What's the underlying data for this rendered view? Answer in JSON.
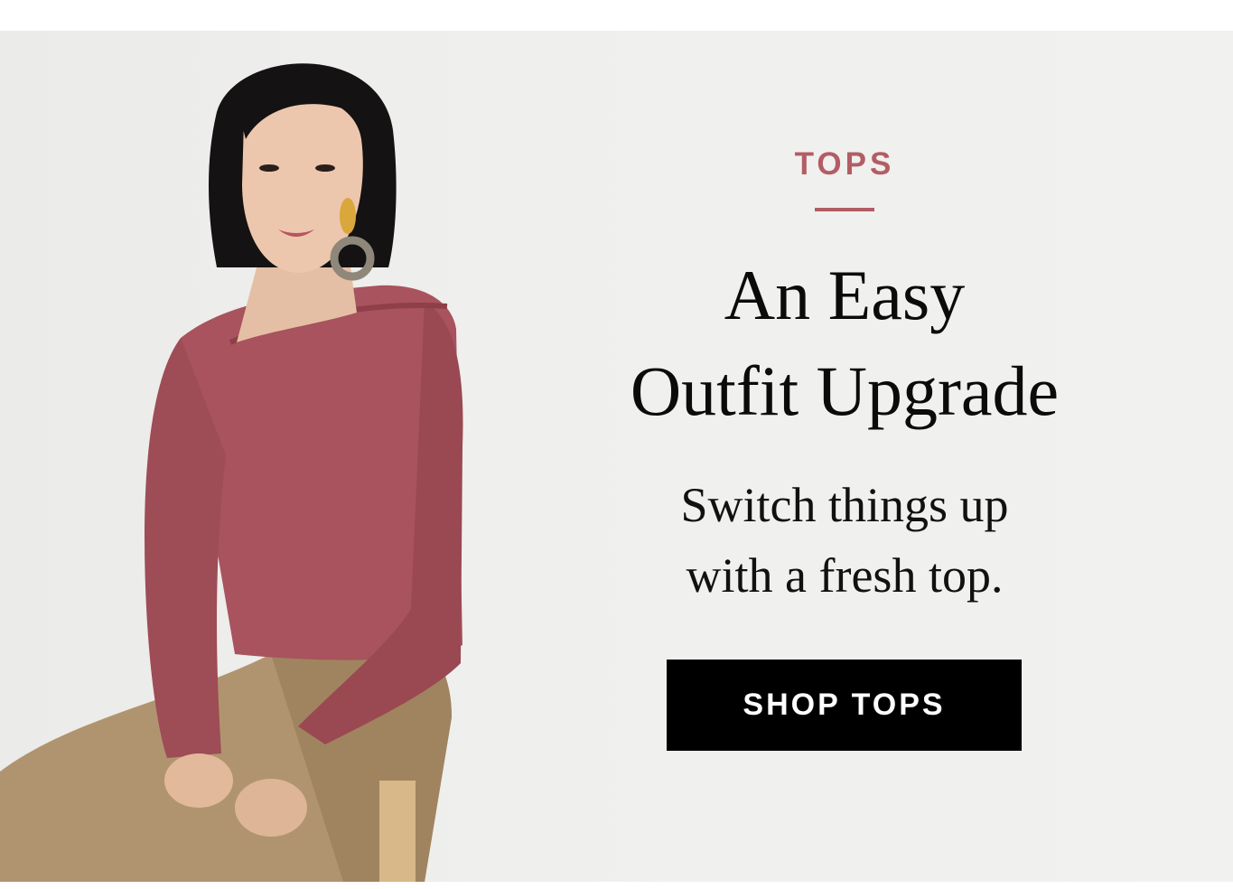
{
  "promo": {
    "eyebrow": "TOPS",
    "headline_line1": "An Easy",
    "headline_line2": "Outfit Upgrade",
    "subcopy_line1": "Switch things up",
    "subcopy_line2": "with a fresh top.",
    "cta_label": "SHOP TOPS"
  },
  "colors": {
    "accent": "#b25d65",
    "button_bg": "#000000",
    "button_text": "#ffffff",
    "background": "#efefed"
  }
}
